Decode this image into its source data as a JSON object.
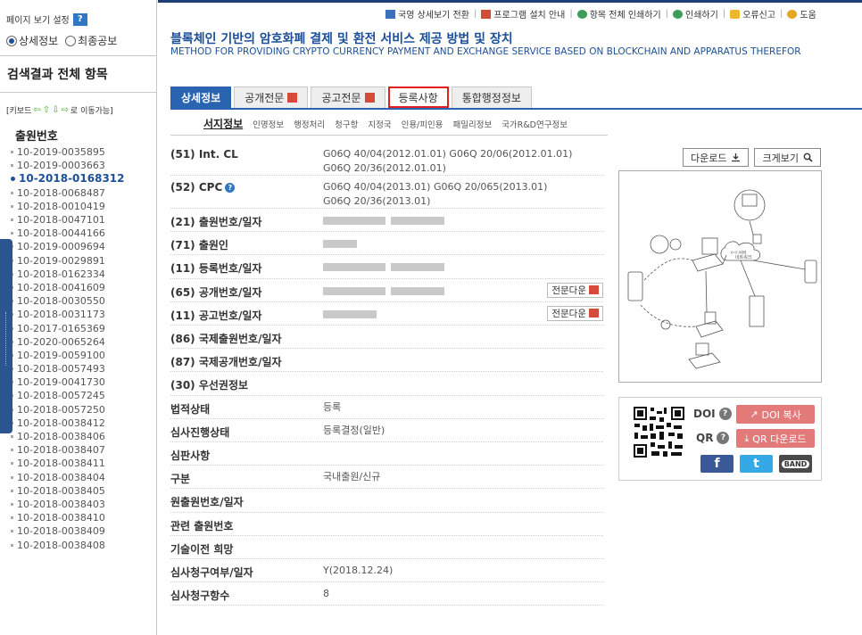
{
  "left": {
    "view_setting_label": "페이지 보기 설정",
    "help_badge": "?",
    "radio_detail": "상세정보",
    "radio_final": "최종공보",
    "result_title": "검색결과 전체 항목",
    "kbd_prefix": "[키보드",
    "kbd_suffix": "로 이동가능]",
    "app_header": "출원번호",
    "active_index": 2,
    "app_numbers": [
      "10-2019-0035895",
      "10-2019-0003663",
      "10-2018-0168312",
      "10-2018-0068487",
      "10-2018-0010419",
      "10-2018-0047101",
      "10-2018-0044166",
      "10-2019-0009694",
      "10-2019-0029891",
      "10-2018-0162334",
      "10-2018-0041609",
      "10-2018-0030550",
      "10-2018-0031173",
      "10-2017-0165369",
      "10-2020-0065264",
      "10-2019-0059100",
      "10-2018-0057493",
      "10-2019-0041730",
      "10-2018-0057245",
      "10-2018-0057250",
      "10-2018-0038412",
      "10-2018-0038406",
      "10-2018-0038407",
      "10-2018-0038411",
      "10-2018-0038404",
      "10-2018-0038405",
      "10-2018-0038403",
      "10-2018-0038410",
      "10-2018-0038409",
      "10-2018-0038408"
    ]
  },
  "topbar": {
    "links": [
      {
        "label": "국영 상세보기 전환",
        "icon": "globe-icon",
        "color": "blue"
      },
      {
        "label": "프로그램 설치 안내",
        "icon": "pdf-icon",
        "color": "red"
      },
      {
        "label": "항목 전체 인쇄하기",
        "icon": "print-all-icon",
        "color": "green"
      },
      {
        "label": "인쇄하기",
        "icon": "print-icon",
        "color": "green"
      },
      {
        "label": "오류신고",
        "icon": "warning-icon",
        "color": "orange"
      },
      {
        "label": "도움",
        "icon": "help-icon",
        "color": "gold"
      }
    ]
  },
  "title": {
    "korean": "블록체인 기반의 암호화폐 결제 및 환전 서비스 제공 방법 및 장치",
    "english": "METHOD FOR PROVIDING CRYPTO CURRENCY PAYMENT AND EXCHANGE SERVICE BASED ON BLOCKCHAIN AND APPARATUS THEREFOR"
  },
  "tabs": [
    {
      "label": "상세정보",
      "pdf": false,
      "state": "active"
    },
    {
      "label": "공개전문",
      "pdf": true,
      "state": ""
    },
    {
      "label": "공고전문",
      "pdf": true,
      "state": ""
    },
    {
      "label": "등록사항",
      "pdf": false,
      "state": "highlight"
    },
    {
      "label": "통합행정정보",
      "pdf": false,
      "state": ""
    }
  ],
  "subtabs": [
    "서지정보",
    "인명정보",
    "행정처리",
    "청구항",
    "지정국",
    "인용/피인용",
    "패밀리정보",
    "국가R&D연구정보"
  ],
  "info_rows": [
    {
      "label": "(51) Int. CL",
      "value": "G06Q 40/04(2012.01.01) G06Q 20/06(2012.01.01)\nG06Q 20/36(2012.01.01)",
      "tall": true
    },
    {
      "label": "(52) CPC",
      "help": true,
      "value": "G06Q 40/04(2013.01) G06Q 20/065(2013.01)\nG06Q 20/36(2013.01)",
      "tall": true
    },
    {
      "label": "(21) 출원번호/일자",
      "blur": [
        70,
        60
      ]
    },
    {
      "label": "(71) 출원인",
      "blur": [
        38
      ]
    },
    {
      "label": "(11) 등록번호/일자",
      "blur": [
        70,
        60
      ]
    },
    {
      "label": "(65) 공개번호/일자",
      "blur": [
        70,
        60
      ],
      "button": "전문다운"
    },
    {
      "label": "(11) 공고번호/일자",
      "blur": [
        60
      ],
      "button": "전문다운"
    },
    {
      "label": "(86) 국제출원번호/일자"
    },
    {
      "label": "(87) 국제공개번호/일자"
    },
    {
      "label": "(30) 우선권정보"
    },
    {
      "label": "법적상태",
      "value": "등록"
    },
    {
      "label": "심사진행상태",
      "value": "등록결정(일반)"
    },
    {
      "label": "심판사항"
    },
    {
      "label": "구분",
      "value": "국내출원/신규"
    },
    {
      "label": "원출원번호/일자"
    },
    {
      "label": "관련 출원번호"
    },
    {
      "label": "기술이전 희망"
    },
    {
      "label": "심사청구여부/일자",
      "value": "Y(2018.12.24)"
    },
    {
      "label": "심사청구항수",
      "value": "8"
    }
  ],
  "right": {
    "download_label": "다운로드",
    "zoom_label": "크게보기",
    "drawing_labels": {
      "server": "ㅇㅇ서버",
      "cloud": "네트워크"
    },
    "doi_label": "DOI",
    "qr_label": "QR",
    "doi_copy": "DOI 복사",
    "qr_download": "QR 다운로드",
    "facebook": "f",
    "twitter": "t",
    "band": "BAND",
    "colors": {
      "facebook": "#3b5998",
      "twitter": "#35a9e6",
      "band": "#4a4a4a",
      "pink_button": "#e27a7a"
    }
  }
}
